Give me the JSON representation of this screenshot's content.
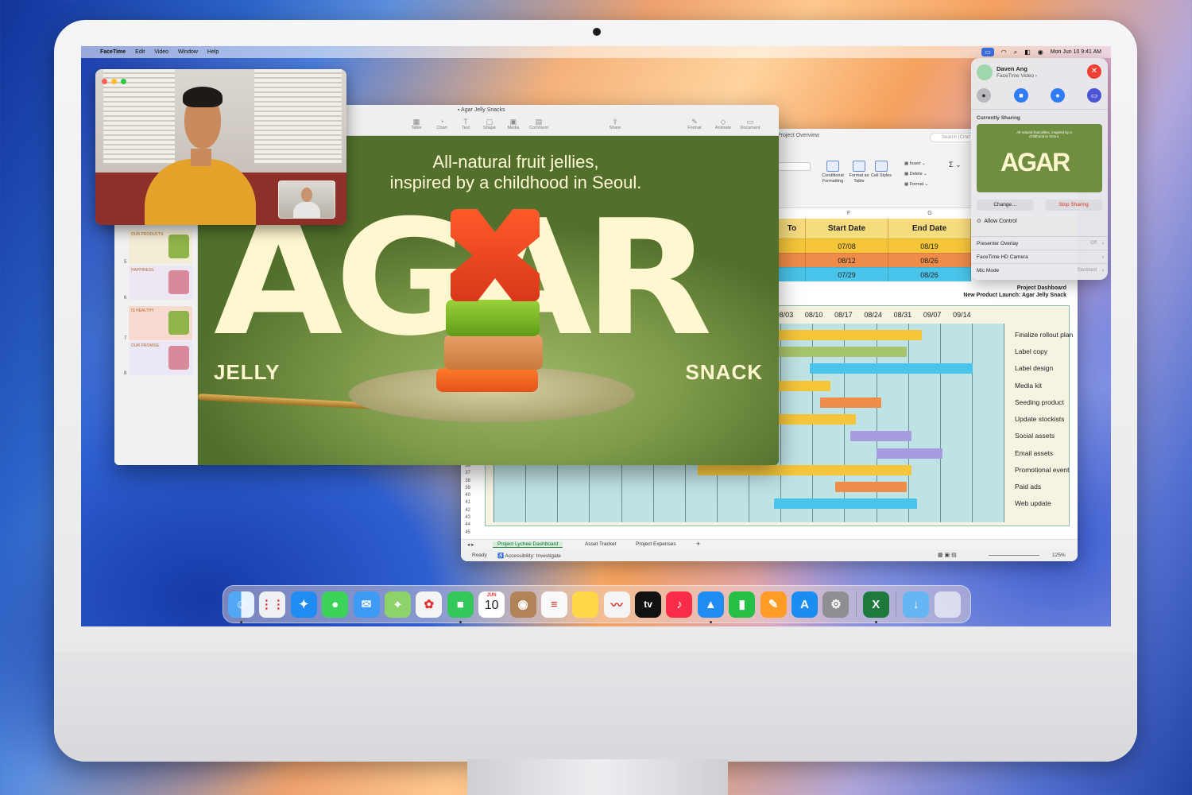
{
  "menubar": {
    "app": "FaceTime",
    "items": [
      "Edit",
      "Video",
      "Window",
      "Help"
    ],
    "datetime": "Mon Jun 10  9:41 AM"
  },
  "excel": {
    "title": "Project Overview",
    "search_placeholder": "Search (Cmd + Ctrl + U)",
    "ribbon": {
      "conditional": "Conditional Formatting",
      "format_table": "Format as Table",
      "cell_styles": "Cell Styles",
      "insert": "Insert",
      "delete": "Delete",
      "format": "Format"
    },
    "col_f": "F",
    "col_g": "G",
    "headers": [
      "To",
      "Start Date",
      "End Date"
    ],
    "rows": [
      {
        "a": "",
        "start": "07/08",
        "end": "08/19",
        "color": "#f6c63a"
      },
      {
        "a": "",
        "start": "08/12",
        "end": "08/26",
        "color": "#f08c4a"
      },
      {
        "a": "",
        "start": "07/29",
        "end": "08/26",
        "color": "#49c4ea"
      }
    ],
    "dashboard_title": "Project Dashboard",
    "dashboard_sub": "New Product Launch: Agar Jelly Snack",
    "dates": [
      "08/03",
      "08/10",
      "08/17",
      "08/24",
      "08/31",
      "09/07",
      "09/14"
    ],
    "row_numbers": [
      "36",
      "37",
      "38",
      "39",
      "40",
      "41",
      "42",
      "43",
      "44",
      "45"
    ],
    "tasks": [
      {
        "label": "Finalize rollout plan",
        "start": 0.04,
        "end": 0.84,
        "color": "#f6c63a"
      },
      {
        "label": "Label copy",
        "start": 0.06,
        "end": 0.81,
        "color": "#a6c46a"
      },
      {
        "label": "Label design",
        "start": 0.62,
        "end": 0.94,
        "color": "#49c4ea"
      },
      {
        "label": "Media kit",
        "start": 0.18,
        "end": 0.66,
        "color": "#f6c63a"
      },
      {
        "label": "Seeding product",
        "start": 0.64,
        "end": 0.76,
        "color": "#f08c4a"
      },
      {
        "label": "Update stockists",
        "start": 0.2,
        "end": 0.71,
        "color": "#f6c63a"
      },
      {
        "label": "Social assets",
        "start": 0.7,
        "end": 0.82,
        "color": "#a99be0"
      },
      {
        "label": "Email assets",
        "start": 0.75,
        "end": 0.88,
        "color": "#a99be0"
      },
      {
        "label": "Promotional event",
        "start": 0.4,
        "end": 0.82,
        "color": "#f6c63a"
      },
      {
        "label": "Paid ads",
        "start": 0.67,
        "end": 0.81,
        "color": "#f08c4a"
      },
      {
        "label": "Web update",
        "start": 0.55,
        "end": 0.83,
        "color": "#49c4ea"
      }
    ],
    "sheet_tabs": [
      "Project Lychee Dashboard",
      "Asset Tracker",
      "Project Expenses"
    ],
    "status": "Ready",
    "accessibility": "Accessibility: Investigate",
    "zoom": "125%"
  },
  "keynote": {
    "title": "Agar Jelly Snacks",
    "toolbar": [
      "Table",
      "Chart",
      "Text",
      "Shape",
      "Media",
      "Comment",
      "Share",
      "Format",
      "Animate",
      "Document"
    ],
    "slide_headline_1": "All-natural fruit jellies,",
    "slide_headline_2": "inspired by a childhood in Seoul.",
    "slide_word": "AGAR",
    "slide_left": "JELLY",
    "slide_right": "SNACK",
    "thumb_numbers": [
      "3",
      "4",
      "5",
      "6",
      "7",
      "8"
    ],
    "thumb_texts": [
      "to be · naturally vegan and naturally delicious.",
      "OUR STORY",
      "We believe · a childlike delight for sweets doesn't need to disappear · with the responsibility of adulthood.",
      "OUR PRODUCTS",
      "HAPPINESS",
      "IS HEALTHY",
      "OUR PROMISE"
    ]
  },
  "facetime_panel": {
    "name": "Daven Ang",
    "subtitle": "FaceTime Video  ›",
    "currently_sharing": "Currently Sharing",
    "change": "Change…",
    "stop": "Stop Sharing",
    "allow": "Allow Control",
    "presenter_overlay": "Presenter Overlay",
    "presenter_value": "Off",
    "camera": "FaceTime HD Camera",
    "mic": "Mic Mode",
    "mic_value": "Standard",
    "preview_text": "All-natural fruit jellies, inspired by a childhood in Seoul.",
    "preview_word": "AGAR"
  },
  "dock": {
    "calendar_month": "JUN",
    "calendar_day": "10",
    "tv_label": "tv",
    "apps": [
      "finder",
      "launchpad",
      "safari",
      "messages",
      "mail",
      "maps",
      "photos",
      "facetime",
      "calendar",
      "contacts",
      "reminders",
      "notes",
      "freeform",
      "tv",
      "music",
      "keynote",
      "numbers",
      "pages",
      "app-store",
      "system-settings",
      "excel",
      "downloads",
      "trash"
    ]
  }
}
